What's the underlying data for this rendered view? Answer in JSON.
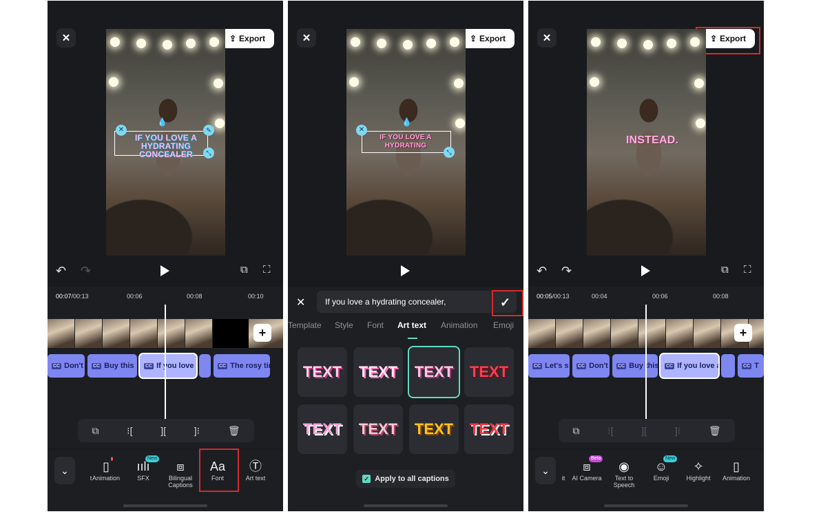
{
  "panels": {
    "p1": {
      "export_label": "Export",
      "caption_art_line1": "IF YOU LOVE A",
      "caption_art_line2": "HYDRATING CONCEALER",
      "tc_current": "00:07",
      "tc_total": "/00:13",
      "ticks": [
        "00:06",
        "00:08",
        "00:10"
      ],
      "captions": [
        {
          "label": "Don't"
        },
        {
          "label": "Buy this"
        },
        {
          "label": "If you love"
        },
        {
          "label": "The rosy tir"
        }
      ],
      "cc_label": "CC",
      "tools": [
        {
          "label": "t"
        },
        {
          "label": "Animation"
        },
        {
          "label": "SFX",
          "badge": "New"
        },
        {
          "label": "Bilingual Captions"
        },
        {
          "label": "Font"
        },
        {
          "label": "Art text"
        }
      ]
    },
    "p2": {
      "export_label": "Export",
      "caption_art": "IF YOU LOVE A HYDRATING",
      "input_value": "If you love a hydrating concealer,",
      "tabs": [
        {
          "label": "Template"
        },
        {
          "label": "Style"
        },
        {
          "label": "Font"
        },
        {
          "label": "Art text"
        },
        {
          "label": "Animation"
        },
        {
          "label": "Emoji"
        }
      ],
      "tile_text": "TEXT",
      "apply_label": "Apply to all captions"
    },
    "p3": {
      "export_label": "Export",
      "caption_art": "INSTEAD.",
      "tc_current": "00:05",
      "tc_total": "/00:13",
      "ticks": [
        "00:04",
        "00:06",
        "00:08"
      ],
      "captions": [
        {
          "label": "Let's s"
        },
        {
          "label": "Don't"
        },
        {
          "label": "Buy this"
        },
        {
          "label": "If you love a"
        },
        {
          "label": "T"
        }
      ],
      "cc_label": "CC",
      "tools": [
        {
          "label": "it"
        },
        {
          "label": "AI Camera",
          "badge": "Beta"
        },
        {
          "label": "Text to Speech"
        },
        {
          "label": "Emoji",
          "badge": "New"
        },
        {
          "label": "Highlight"
        },
        {
          "label": "Animation"
        }
      ]
    }
  },
  "colors": {
    "panel_bg": "#181a1e",
    "caption_clip": "#7e87f0",
    "accent_teal": "#62d9c2",
    "highlight_red": "#d62b2b"
  }
}
